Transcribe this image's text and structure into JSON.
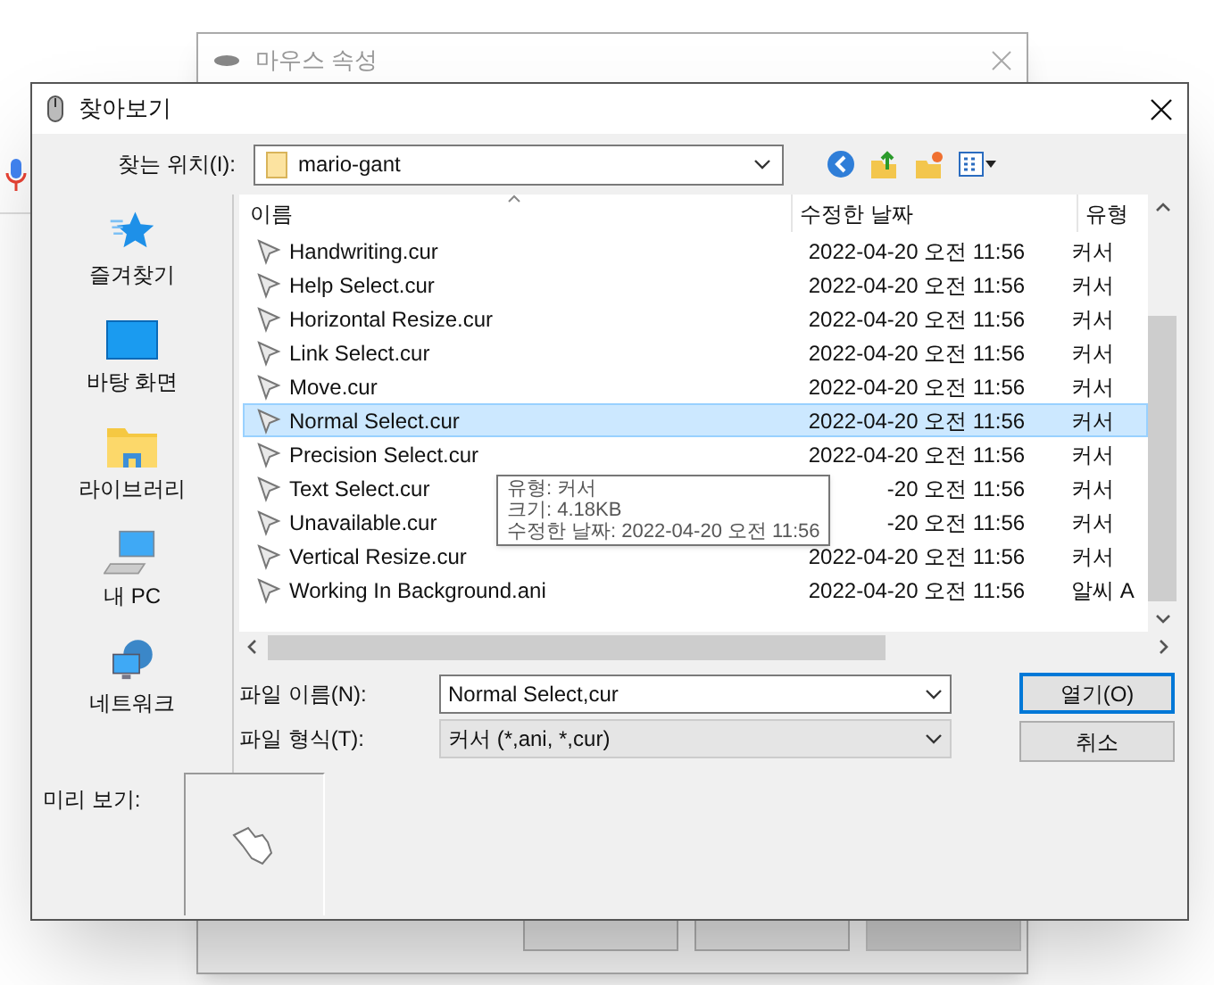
{
  "background_window": {
    "title": "마우스 속성"
  },
  "dialog": {
    "title": "찾아보기",
    "look_in": {
      "label": "찾는 위치(I):",
      "value": "mario-gant"
    },
    "places": [
      {
        "kind": "favorites",
        "label": "즐겨찾기"
      },
      {
        "kind": "desktop",
        "label": "바탕 화면"
      },
      {
        "kind": "library",
        "label": "라이브러리"
      },
      {
        "kind": "pc",
        "label": "내 PC"
      },
      {
        "kind": "network",
        "label": "네트워크"
      }
    ],
    "columns": [
      "이름",
      "수정한 날짜",
      "유형"
    ],
    "rows": [
      {
        "name": "Handwriting.cur",
        "modified": "2022-04-20 오전 11:56",
        "type": "커서",
        "selected": false
      },
      {
        "name": "Help Select.cur",
        "modified": "2022-04-20 오전 11:56",
        "type": "커서",
        "selected": false
      },
      {
        "name": "Horizontal Resize.cur",
        "modified": "2022-04-20 오전 11:56",
        "type": "커서",
        "selected": false
      },
      {
        "name": "Link Select.cur",
        "modified": "2022-04-20 오전 11:56",
        "type": "커서",
        "selected": false
      },
      {
        "name": "Move.cur",
        "modified": "2022-04-20 오전 11:56",
        "type": "커서",
        "selected": false
      },
      {
        "name": "Normal Select.cur",
        "modified": "2022-04-20 오전 11:56",
        "type": "커서",
        "selected": true
      },
      {
        "name": "Precision Select.cur",
        "modified": "2022-04-20 오전 11:56",
        "type": "커서",
        "selected": false
      },
      {
        "name": "Text Select.cur",
        "modified": "-20 오전 11:56",
        "type": "커서",
        "selected": false
      },
      {
        "name": "Unavailable.cur",
        "modified": "-20 오전 11:56",
        "type": "커서",
        "selected": false
      },
      {
        "name": "Vertical Resize.cur",
        "modified": "2022-04-20 오전 11:56",
        "type": "커서",
        "selected": false
      },
      {
        "name": "Working In Background.ani",
        "modified": "2022-04-20 오전 11:56",
        "type": "알씨 A",
        "selected": false
      }
    ],
    "tooltip": [
      "유형: 커서",
      "크기: 4.18KB",
      "수정한 날짜: 2022-04-20 오전 11:56"
    ],
    "file_name": {
      "label": "파일 이름(N):",
      "value": "Normal Select,cur"
    },
    "file_type": {
      "label": "파일 형식(T):",
      "value": "커서 (*,ani, *,cur)"
    },
    "buttons": [
      {
        "label": "열기(O)",
        "default": true
      },
      {
        "label": "취소",
        "default": false
      }
    ],
    "preview": {
      "label": "미리 보기:"
    }
  }
}
